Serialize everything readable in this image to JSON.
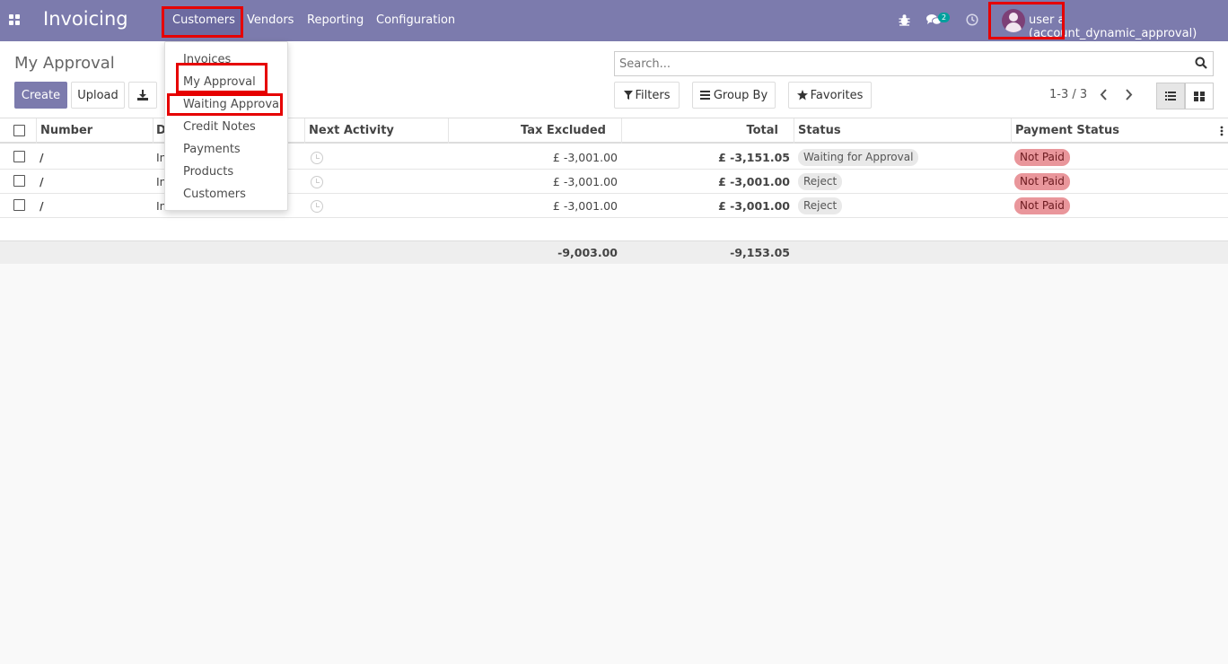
{
  "navbar": {
    "brand": "Invoicing",
    "menu": [
      "Customers",
      "Vendors",
      "Reporting",
      "Configuration"
    ],
    "message_count": "2",
    "user": "user a (account_dynamic_approval)"
  },
  "dropdown": {
    "items": [
      "Invoices",
      "My Approval",
      "Waiting Approval",
      "Credit Notes",
      "Payments",
      "Products",
      "Customers"
    ]
  },
  "control": {
    "title": "My Approval",
    "create_label": "Create",
    "upload_label": "Upload",
    "search_placeholder": "Search...",
    "filters_label": "Filters",
    "group_by_label": "Group By",
    "favorites_label": "Favorites",
    "pager": "1-3 / 3"
  },
  "table": {
    "headers": [
      "Number",
      "D",
      "Next Activity",
      "Tax Excluded",
      "Total",
      "Status",
      "Payment Status"
    ],
    "rows": [
      {
        "number": "/",
        "partial": "In",
        "tax_excluded": "£ -3,001.00",
        "total": "£ -3,151.05",
        "status": "Waiting for Approval",
        "payment_status": "Not Paid"
      },
      {
        "number": "/",
        "partial": "In",
        "tax_excluded": "£ -3,001.00",
        "total": "£ -3,001.00",
        "status": "Reject",
        "payment_status": "Not Paid"
      },
      {
        "number": "/",
        "partial": "In",
        "tax_excluded": "£ -3,001.00",
        "total": "£ -3,001.00",
        "status": "Reject",
        "payment_status": "Not Paid"
      }
    ],
    "totals": {
      "tax_excluded": "-9,003.00",
      "total": "-9,153.05"
    }
  },
  "colors": {
    "brand": "#7c7bad",
    "highlight": "#e60000",
    "not_paid": "#e9969b"
  }
}
